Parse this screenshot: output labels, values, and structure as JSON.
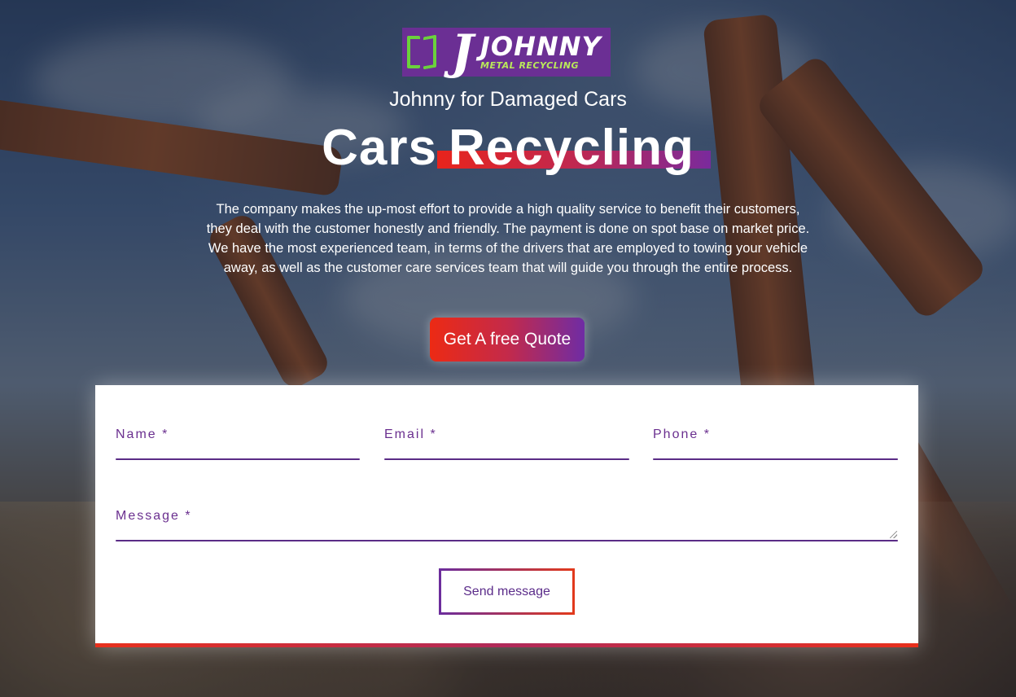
{
  "brand": {
    "logo_name": "JOHNNY",
    "logo_sub": "METAL RECYCLING",
    "logo_letter": "J"
  },
  "hero": {
    "subtitle": "Johnny for Damaged Cars",
    "title_plain": "Cars",
    "title_highlight": "Recycling",
    "description": "The company makes the up-most effort to provide a high quality service to benefit their customers, they deal with the customer honestly and friendly. The payment is done on spot base on market price. We have the most experienced team, in terms of the drivers that are employed to towing your vehicle away, as well as the customer care services team that will guide you through the entire process.",
    "cta_label": "Get A free Quote"
  },
  "form": {
    "name_label": "Name *",
    "email_label": "Email *",
    "phone_label": "Phone *",
    "message_label": "Message *",
    "submit_label": "Send message"
  },
  "colors": {
    "brand_purple": "#6b2f94",
    "brand_green": "#6bd13c",
    "accent_red": "#ec2a14",
    "label_purple": "#6a2f8f"
  }
}
